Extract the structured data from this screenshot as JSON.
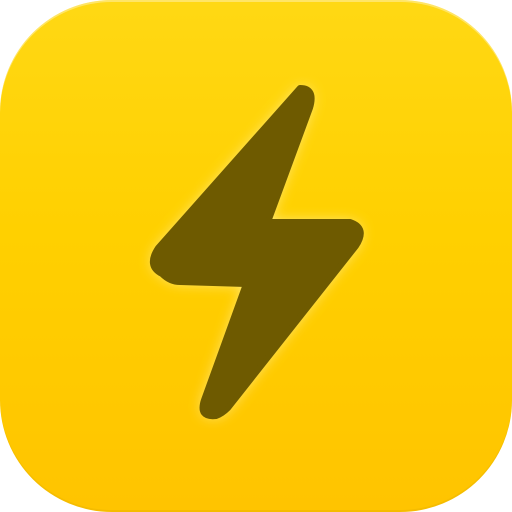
{
  "icon": {
    "name": "lightning-bolt-icon",
    "tile_color_top": "#FFD814",
    "tile_color_bottom": "#FFC400",
    "bolt_color": "#6E5A00",
    "glow_color": "#FFF2A0"
  }
}
